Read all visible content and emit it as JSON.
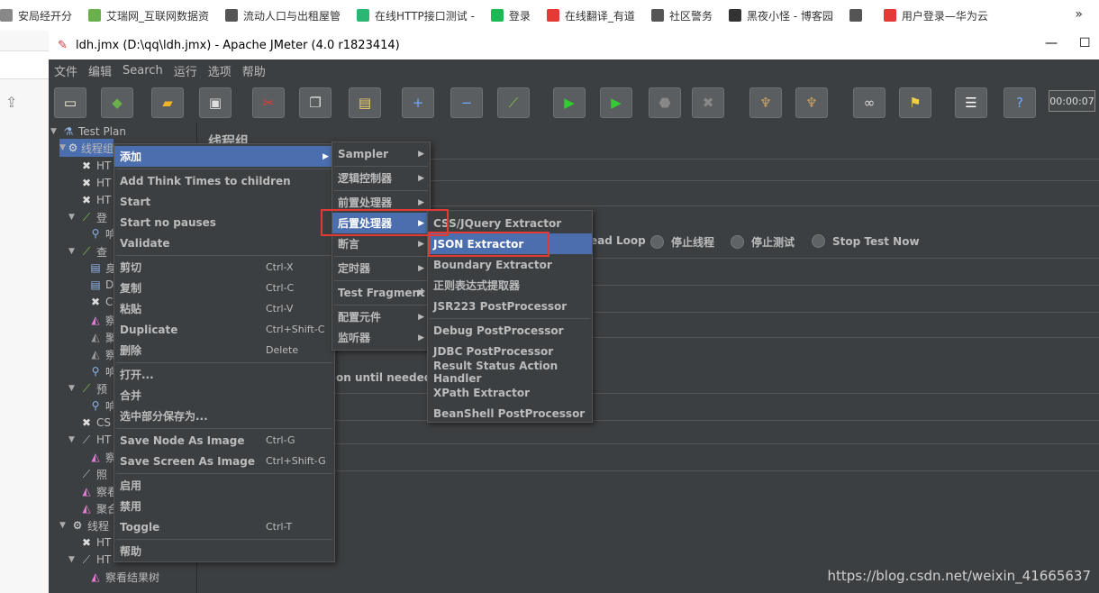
{
  "bookmarks": [
    {
      "label": "安局经开分",
      "icon": "folder-icon",
      "color": "#888888"
    },
    {
      "label": "艾瑞网_互联网数据资",
      "icon": "r-logo-icon",
      "color": "#6ab04c"
    },
    {
      "label": "流动人口与出租屋管",
      "icon": "page-icon",
      "color": "#555555"
    },
    {
      "label": "在线HTTP接口测试 -",
      "icon": "gear-icon",
      "color": "#2bb673"
    },
    {
      "label": "登录",
      "icon": "lightning-icon",
      "color": "#1db954"
    },
    {
      "label": "在线翻译_有道",
      "icon": "youdao-icon",
      "color": "#e53935"
    },
    {
      "label": "社区警务",
      "icon": "page-icon",
      "color": "#555555"
    },
    {
      "label": "黑夜小怪 - 博客园",
      "icon": "mask-icon",
      "color": "#333333"
    },
    {
      "label": "",
      "icon": "page-icon",
      "color": "#555555"
    },
    {
      "label": "用户登录—华为云",
      "icon": "huawei-icon",
      "color": "#e53935"
    }
  ],
  "bookmarks_more": "»",
  "window": {
    "title": "ldh.jmx (D:\\qq\\ldh.jmx) - Apache JMeter (4.0 r1823414)",
    "minimize": "—",
    "maximize": "☐"
  },
  "menubar": [
    "文件",
    "编辑",
    "Search",
    "运行",
    "选项",
    "帮助"
  ],
  "toolbar": {
    "timer": "00:00:07",
    "buttons": [
      {
        "name": "new-icon",
        "glyph": "▭",
        "color": "#f5f5dc"
      },
      {
        "name": "templates-icon",
        "glyph": "◆",
        "color": "#6ab04c"
      },
      {
        "name": "open-icon",
        "glyph": "▰",
        "color": "#f0b429"
      },
      {
        "name": "save-icon",
        "glyph": "▣",
        "color": "#dddddd"
      },
      {
        "name": "cut-icon",
        "glyph": "✂",
        "color": "#e53935"
      },
      {
        "name": "copy-icon",
        "glyph": "❐",
        "color": "#dddddd"
      },
      {
        "name": "paste-icon",
        "glyph": "▤",
        "color": "#f0d070"
      },
      {
        "name": "expand-icon",
        "glyph": "+",
        "color": "#6fa8ff"
      },
      {
        "name": "collapse-icon",
        "glyph": "−",
        "color": "#6fa8ff"
      },
      {
        "name": "toggle-icon",
        "glyph": "⟋",
        "color": "#8bc34a"
      },
      {
        "name": "start-icon",
        "glyph": "▶",
        "color": "#33cc33"
      },
      {
        "name": "start-no-pauses-icon",
        "glyph": "▶",
        "color": "#33cc33"
      },
      {
        "name": "stop-icon",
        "glyph": "⬣",
        "color": "#888888"
      },
      {
        "name": "shutdown-icon",
        "glyph": "✖",
        "color": "#888888"
      },
      {
        "name": "clear-icon",
        "glyph": "♆",
        "color": "#c8a060"
      },
      {
        "name": "clear-all-icon",
        "glyph": "♆",
        "color": "#c8a060"
      },
      {
        "name": "search-icon",
        "glyph": "∞",
        "color": "#dddddd"
      },
      {
        "name": "reset-search-icon",
        "glyph": "⚑",
        "color": "#f0d040"
      },
      {
        "name": "function-helper-icon",
        "glyph": "☰",
        "color": "#ffffff"
      },
      {
        "name": "help-icon",
        "glyph": "?",
        "color": "#6fa8ff"
      }
    ]
  },
  "tree": [
    {
      "label": "Test Plan",
      "icon": "flask-icon",
      "color": "#8fb4e8",
      "twisty": "▼",
      "indent": 0
    },
    {
      "label": "线程组",
      "icon": "gear-icon",
      "color": "#dddddd",
      "twisty": "▼",
      "indent": 1,
      "selected": true
    },
    {
      "label": "HT",
      "icon": "sampler-icon",
      "color": "#dddddd",
      "twisty": "",
      "indent": 2
    },
    {
      "label": "HT",
      "icon": "sampler-icon",
      "color": "#dddddd",
      "twisty": "",
      "indent": 2
    },
    {
      "label": "HT",
      "icon": "sampler-icon",
      "color": "#dddddd",
      "twisty": "",
      "indent": 2
    },
    {
      "label": "登",
      "icon": "pipette-icon",
      "color": "#8bc34a",
      "twisty": "▼",
      "indent": 2
    },
    {
      "label": "响",
      "icon": "magnifier-icon",
      "color": "#8fb4e8",
      "twisty": "",
      "indent": 3
    },
    {
      "label": "查",
      "icon": "pipette-icon",
      "color": "#8bc34a",
      "twisty": "▼",
      "indent": 2
    },
    {
      "label": "身",
      "icon": "doc-icon",
      "color": "#8fb4e8",
      "twisty": "",
      "indent": 3
    },
    {
      "label": "D",
      "icon": "doc-icon",
      "color": "#8fb4e8",
      "twisty": "",
      "indent": 3
    },
    {
      "label": "C",
      "icon": "sampler-icon",
      "color": "#dddddd",
      "twisty": "",
      "indent": 3
    },
    {
      "label": "察",
      "icon": "chart-icon",
      "color": "#e57bd0",
      "twisty": "",
      "indent": 3
    },
    {
      "label": "聚",
      "icon": "chart-icon",
      "color": "#999999",
      "twisty": "",
      "indent": 3
    },
    {
      "label": "察",
      "icon": "chart-icon",
      "color": "#999999",
      "twisty": "",
      "indent": 3
    },
    {
      "label": "响",
      "icon": "magnifier-icon",
      "color": "#8fb4e8",
      "twisty": "",
      "indent": 3
    },
    {
      "label": "预",
      "icon": "pipette-icon",
      "color": "#8bc34a",
      "twisty": "▼",
      "indent": 2
    },
    {
      "label": "响",
      "icon": "magnifier-icon",
      "color": "#8fb4e8",
      "twisty": "",
      "indent": 3
    },
    {
      "label": "CS",
      "icon": "sampler-icon",
      "color": "#dddddd",
      "twisty": "",
      "indent": 2
    },
    {
      "label": "HT",
      "icon": "pipette-icon",
      "color": "#bbbbbb",
      "twisty": "▼",
      "indent": 2
    },
    {
      "label": "察",
      "icon": "chart-icon",
      "color": "#e57bd0",
      "twisty": "",
      "indent": 3
    },
    {
      "label": "照",
      "icon": "pipette-icon",
      "color": "#bbbbbb",
      "twisty": "",
      "indent": 2
    },
    {
      "label": "察看",
      "icon": "chart-icon",
      "color": "#e57bd0",
      "twisty": "",
      "indent": 2
    },
    {
      "label": "聚合",
      "icon": "chart-icon",
      "color": "#e57bd0",
      "twisty": "",
      "indent": 2
    },
    {
      "label": "线程",
      "icon": "gear-icon",
      "color": "#dddddd",
      "twisty": "▼",
      "indent": 1
    },
    {
      "label": "HT",
      "icon": "sampler-icon",
      "color": "#dddddd",
      "twisty": "",
      "indent": 2
    },
    {
      "label": "HT",
      "icon": "pipette-icon",
      "color": "#bbbbbb",
      "twisty": "▼",
      "indent": 2
    },
    {
      "label": "察看结果树",
      "icon": "chart-icon",
      "color": "#e57bd0",
      "twisty": "",
      "indent": 3
    }
  ],
  "main": {
    "title": "线程组",
    "radios": [
      "ead Loop",
      "停止线程",
      "停止测试",
      "Stop Test Now"
    ],
    "partial_text": "on until needed"
  },
  "context_menu": {
    "items": [
      {
        "label": "添加",
        "shortcut": "",
        "submenu": true,
        "highlight": true
      },
      {
        "sep": true
      },
      {
        "label": "Add Think Times to children",
        "shortcut": ""
      },
      {
        "label": "Start",
        "shortcut": ""
      },
      {
        "label": "Start no pauses",
        "shortcut": ""
      },
      {
        "label": "Validate",
        "shortcut": ""
      },
      {
        "sep": true
      },
      {
        "label": "剪切",
        "shortcut": "Ctrl-X"
      },
      {
        "label": "复制",
        "shortcut": "Ctrl-C"
      },
      {
        "label": "粘贴",
        "shortcut": "Ctrl-V"
      },
      {
        "label": "Duplicate",
        "shortcut": "Ctrl+Shift-C"
      },
      {
        "label": "删除",
        "shortcut": "Delete"
      },
      {
        "sep": true
      },
      {
        "label": "打开...",
        "shortcut": ""
      },
      {
        "label": "合并",
        "shortcut": ""
      },
      {
        "label": "选中部分保存为...",
        "shortcut": ""
      },
      {
        "sep": true
      },
      {
        "label": "Save Node As Image",
        "shortcut": "Ctrl-G"
      },
      {
        "label": "Save Screen As Image",
        "shortcut": "Ctrl+Shift-G"
      },
      {
        "sep": true
      },
      {
        "label": "启用",
        "shortcut": ""
      },
      {
        "label": "禁用",
        "shortcut": ""
      },
      {
        "label": "Toggle",
        "shortcut": "Ctrl-T"
      },
      {
        "sep": true
      },
      {
        "label": "帮助",
        "shortcut": ""
      }
    ]
  },
  "add_submenu": {
    "items": [
      {
        "label": "Sampler",
        "submenu": true
      },
      {
        "sep": true
      },
      {
        "label": "逻辑控制器",
        "submenu": true
      },
      {
        "sep": true
      },
      {
        "label": "前置处理器",
        "submenu": true
      },
      {
        "label": "后置处理器",
        "submenu": true,
        "highlight": true
      },
      {
        "label": "断言",
        "submenu": true
      },
      {
        "sep": true
      },
      {
        "label": "定时器",
        "submenu": true
      },
      {
        "sep": true
      },
      {
        "label": "Test Fragment",
        "submenu": true
      },
      {
        "sep": true
      },
      {
        "label": "配置元件",
        "submenu": true
      },
      {
        "label": "监听器",
        "submenu": true
      }
    ]
  },
  "post_processor_menu": {
    "items": [
      {
        "label": "CSS/JQuery Extractor"
      },
      {
        "label": "JSON Extractor",
        "highlight": true
      },
      {
        "label": "Boundary Extractor"
      },
      {
        "label": "正则表达式提取器"
      },
      {
        "label": "JSR223 PostProcessor"
      },
      {
        "sep": true
      },
      {
        "label": "Debug PostProcessor"
      },
      {
        "label": "JDBC PostProcessor"
      },
      {
        "label": "Result Status Action Handler"
      },
      {
        "label": "XPath Extractor"
      },
      {
        "label": "BeanShell PostProcessor"
      }
    ]
  },
  "watermark": "https://blog.csdn.net/weixin_41665637",
  "accent_color": "#4b6eaf",
  "annotation_color": "#e53935"
}
